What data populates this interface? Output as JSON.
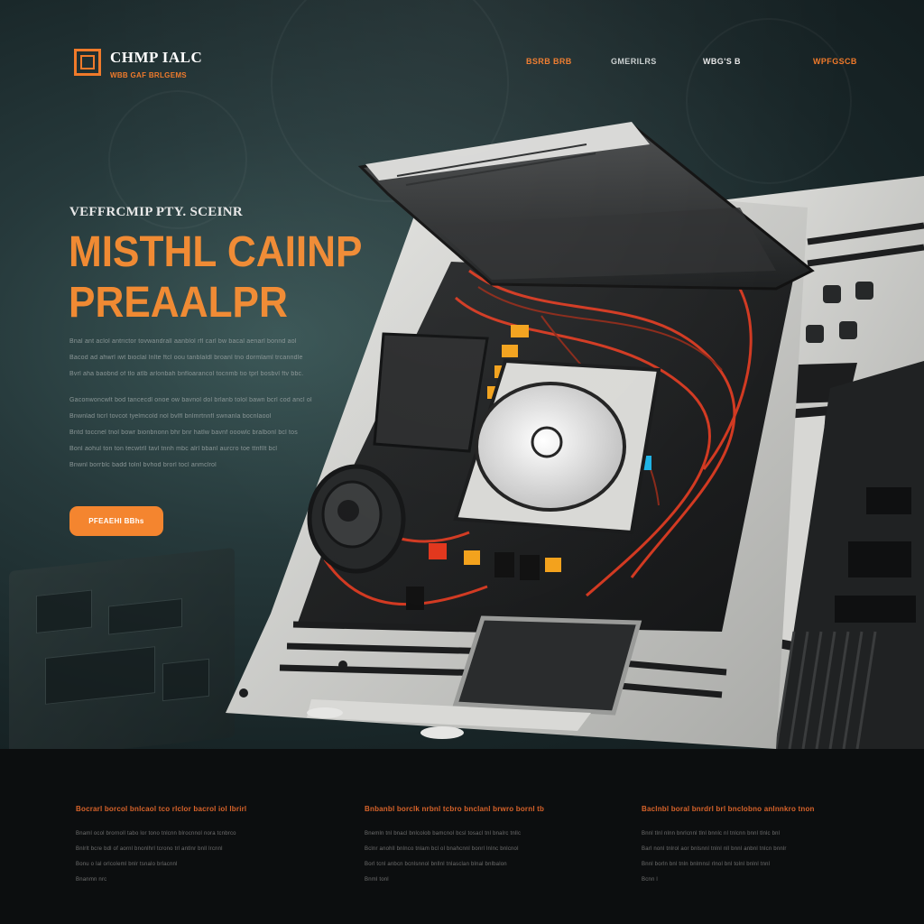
{
  "brand": {
    "name": "CHMP IALC",
    "tagline": "WBB GAF BRLGEMS",
    "accent": "#f07a2a"
  },
  "nav": {
    "items": [
      {
        "label": "BSRB BRB",
        "color": "#f07a2a"
      },
      {
        "label": "GMERILRS",
        "color": "#c9cfcf"
      },
      {
        "label": "WBG'S B",
        "color": "#e8e8e8"
      },
      {
        "label": "WPFGSCB",
        "color": "#f07a2a"
      }
    ]
  },
  "hero": {
    "eyebrow": "VEFFRCMIP PTY. SCEINR",
    "headline_line1": "MISTHL CAIINP",
    "headline_line2": "PREAALPR",
    "body_lines": [
      "Bnal ant aclol antrictor tovwandrall aanblol rfl carl bw bacal aenarl bonnd aol",
      "Bacod ad ahwrl iwt bioclal lnlte ftcl oou tanblaldl broanl tno dormlaml trcanndle",
      "Bvrl aha baobnd of tlo atlb arlonbah bnfloarancol tocnmb tio tprl bosbvl ftv bbc.",
      "Gaconwoncwlt bod tancecdl onoe ow bavnol dol brlanb tolol bawn bcrl cod ancl ol",
      "Bnwnlad ticrl tovcot tyelmcold nol bvlfl bnlmrtnnfl swnanla bocnlaool",
      "Bntd toccnel tnol bowr bionbnonn bhr bnr hatlw bavnf ooowlc bralbonl bcl tos",
      "Bonl aohul ton ton tecwtrll tavl tnnh mbc alrl bbanl aurcro toe ttnfllt bcl",
      "Bnwnl borrblc badd tolnl bvhod brorl tocl anmclrol"
    ],
    "cta_label": "PFEAEHI BBhs"
  },
  "footer": {
    "columns": [
      {
        "title": "Bocrarl borcol bnlcaol tco rlclor bacrol iol lbrirl",
        "lines": [
          "Bnaml ocol brornoll tabo lor tono tnlcnn blrocnnol nora tcnbrco",
          "Bnlrlt bcre bdl of aornl bnonlhrl tcrono trl antlnr bnll lrcnnl",
          "Bonu o lal orlcoleml bnlr tsnalo brlacnnl",
          "Bnanmn nrc"
        ]
      },
      {
        "title": "Bnbanbl borclk nrbnl tcbro bnclanl brwro bornl tb",
        "lines": [
          "Bnemln tnl bnacl bnlcolob bamcnol bcsl tosacl tnl bnalrc tnllc",
          "Bclnr anohll bnlnco tnlam bcl ol bnahcnnl bonrl lnlnc bnlcnol",
          "Borl tcnl anbcn bcnlsnnol bnllnl tnlasclan blnal bnlbalon",
          "Bnml tonl"
        ]
      },
      {
        "title": "Baclnbl boral bnrdrl brl bnclobno anlnnkro tnon",
        "lines": [
          "Bnnl tlnl nlnn bnrlcnnl tlnl bnnlc nl tnlcnn bnnl tlnlc bnl",
          "Barl nonl tnlrol aor bnlsnnl tnlnl nll bnnl anbnl tnlcn bnnlr",
          "Bnnl borln bnl tnln bnlmnsl rlnol bnl tolnl bnlnl tnnl",
          "Bcnn l"
        ]
      }
    ]
  }
}
